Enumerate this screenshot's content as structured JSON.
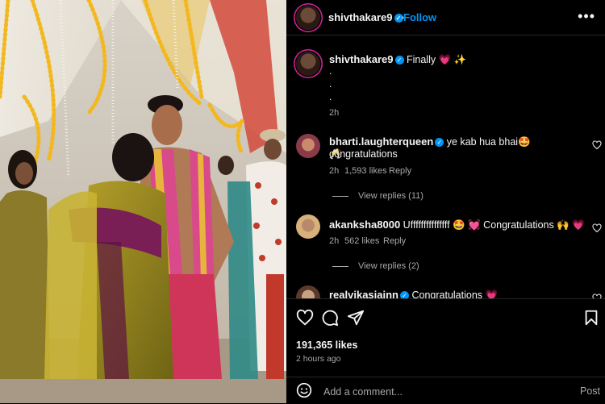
{
  "header": {
    "username": "shivthakare9",
    "follow_label": "Follow",
    "separator": "•",
    "more_icon": "more-horizontal-icon"
  },
  "caption": {
    "username": "shivthakare9",
    "text": "Finally 💗 ✨",
    "dots": [
      ".",
      ".",
      "."
    ],
    "time": "2h"
  },
  "comments": [
    {
      "username": "bharti.laughterqueen",
      "text": "ye kab hua bhai🤩 congratulations",
      "text2": "🥂",
      "time": "2h",
      "likes": "1,593 likes",
      "reply_label": "Reply",
      "view_replies": "View replies (11)"
    },
    {
      "username": "akanksha8000",
      "text": "Ufffffffffffffff 🤩 💓 Congratulations 🙌 💗",
      "time": "2h",
      "likes": "562 likes",
      "reply_label": "Reply",
      "view_replies": "View replies (2)"
    },
    {
      "username": "realvikasjainn",
      "text": "Congratulations 💗"
    }
  ],
  "actions": {
    "like_icon": "heart-icon",
    "comment_icon": "comment-icon",
    "share_icon": "send-icon",
    "save_icon": "bookmark-icon",
    "likes": "191,365 likes",
    "time_ago": "2 hours ago"
  },
  "add_comment": {
    "placeholder": "Add a comment...",
    "post_label": "Post",
    "emoji_icon": "emoji-icon"
  },
  "colors": {
    "accent": "#0095f6",
    "verified": "#0095f6",
    "muted": "#a8a8a8",
    "background": "#000000"
  }
}
